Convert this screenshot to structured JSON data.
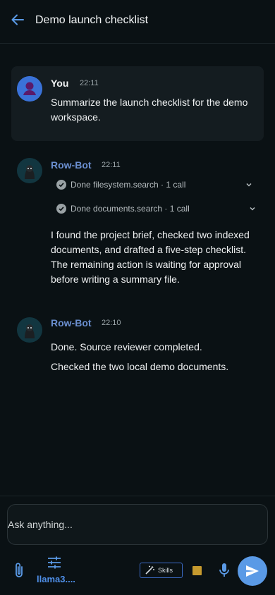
{
  "header": {
    "title": "Demo launch checklist",
    "back_icon": "arrow-left-icon"
  },
  "messages": [
    {
      "author": "You",
      "time": "22:11",
      "text": "Summarize the launch checklist for the demo workspace."
    },
    {
      "author": "Row-Bot",
      "time": "22:11",
      "tools": [
        {
          "status": "Done",
          "label": "Done filesystem.search · 1 call"
        },
        {
          "status": "Done",
          "label": "Done documents.search · 1 call"
        }
      ],
      "text": "I found the project brief, checked two indexed documents, and drafted a five-step checklist. The remaining action is waiting for approval before writing a summary file."
    },
    {
      "author": "Row-Bot",
      "time": "22:10",
      "lines": [
        "Done. Source reviewer completed.",
        "Checked the two local demo documents."
      ]
    }
  ],
  "composer": {
    "placeholder": "Ask anything...",
    "model": "llama3....",
    "skills_label": "Skills"
  },
  "colors": {
    "background": "#0a1114",
    "bot_name": "#6b8fd0",
    "accent": "#5a9ae6",
    "stop": "#c69a2e"
  }
}
